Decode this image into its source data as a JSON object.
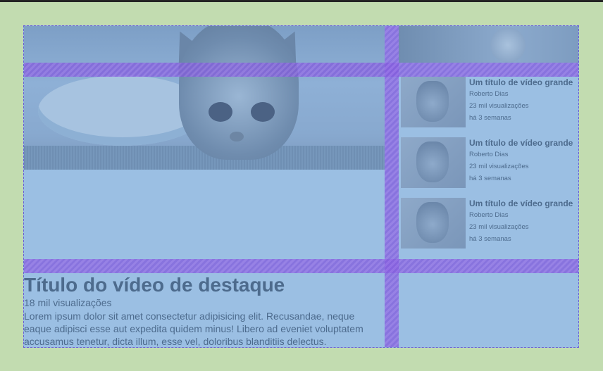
{
  "featured": {
    "title": "Título do vídeo de destaque",
    "views": "18 mil visualizações",
    "description": "Lorem ipsum dolor sit amet consectetur adipisicing elit. Recusandae, neque eaque adipisci esse aut expedita quidem minus! Libero ad eveniet voluptatem accusamus tenetur, dicta illum, esse vel, doloribus blanditiis delectus."
  },
  "sidebar": {
    "items": [
      {
        "title": "Um título de vídeo grande",
        "author": "Roberto Dias",
        "views": "23 mil visualizações",
        "age": "há 3 semanas"
      },
      {
        "title": "Um título de vídeo grande",
        "author": "Roberto Dias",
        "views": "23 mil visualizações",
        "age": "há 3 semanas"
      },
      {
        "title": "Um título de vídeo grande",
        "author": "Roberto Dias",
        "views": "23 mil visualizações",
        "age": "há 3 semanas"
      }
    ]
  },
  "colors": {
    "page_background": "#c2dcb0",
    "grid_overlay": "#9bbfe3",
    "grid_gap": "#966ee6",
    "text": "#4d6b8d"
  }
}
